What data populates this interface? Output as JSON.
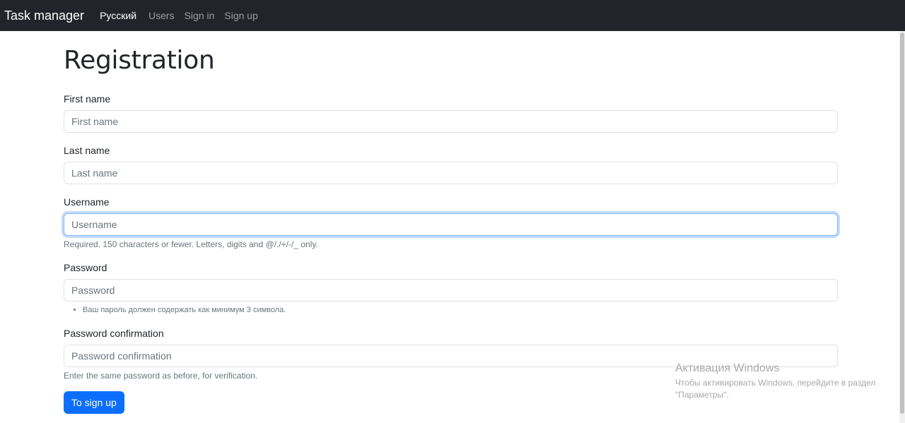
{
  "navbar": {
    "brand": "Task manager",
    "links": [
      {
        "label": "Русский",
        "active": true
      },
      {
        "label": "Users"
      },
      {
        "label": "Sign in"
      },
      {
        "label": "Sign up"
      }
    ]
  },
  "page": {
    "title": "Registration"
  },
  "form": {
    "first_name": {
      "label": "First name",
      "placeholder": "First name"
    },
    "last_name": {
      "label": "Last name",
      "placeholder": "Last name"
    },
    "username": {
      "label": "Username",
      "placeholder": "Username",
      "help": "Required. 150 characters or fewer. Letters, digits and @/./+/-/_ only."
    },
    "password": {
      "label": "Password",
      "placeholder": "Password",
      "help_items": [
        "Ваш пароль должен содержать как минимум 3 символа."
      ]
    },
    "password_confirmation": {
      "label": "Password confirmation",
      "placeholder": "Password confirmation",
      "help": "Enter the same password as before, for verification."
    },
    "submit_label": "To sign up"
  },
  "watermark": {
    "title": "Активация Windows",
    "line1": "Чтобы активировать Windows, перейдите в раздел",
    "line2": "\"Параметры\"."
  },
  "colors": {
    "navbar_bg": "#212529",
    "primary": "#0d6efd",
    "focus_border": "#86b7fe"
  }
}
